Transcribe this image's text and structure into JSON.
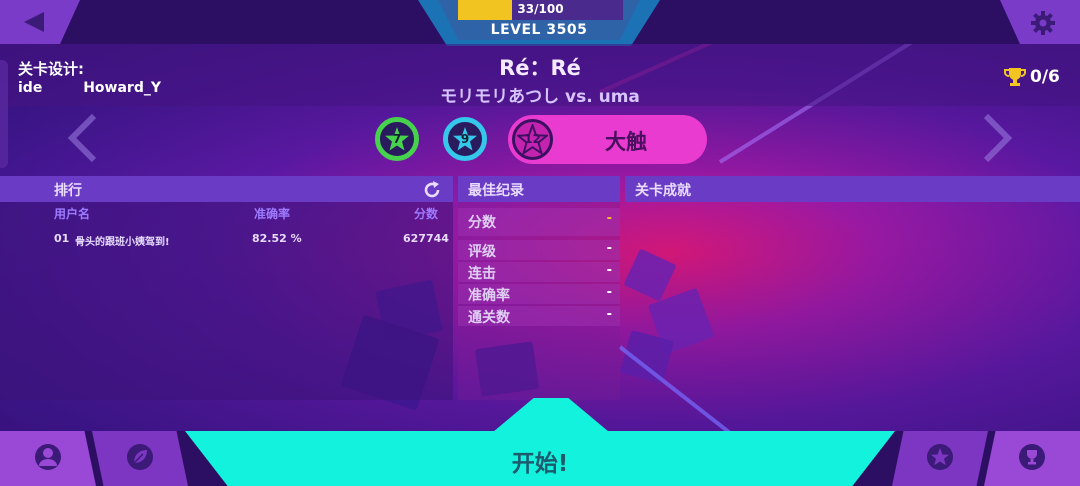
{
  "top": {
    "xp_text": "33/100",
    "xp_progress": 0.33,
    "level_text": "LEVEL 3505",
    "back_icon": "back-arrow-icon",
    "settings_icon": "gear-icon"
  },
  "header": {
    "designer_label": "关卡设计:",
    "designers": [
      "ide",
      "Howard_Y"
    ],
    "song_title": "Ré：Ré",
    "song_artist": "モリモリあつし vs. uma",
    "trophy_count": "0/6"
  },
  "difficulties": [
    {
      "level": "7",
      "color": "#47d24e"
    },
    {
      "level": "9",
      "color": "#35c8ea"
    },
    {
      "level": "12",
      "label": "大触",
      "color": "#ea3bd0",
      "selected": true
    }
  ],
  "ranking": {
    "title": "排行",
    "columns": [
      "用户名",
      "准确率",
      "分数"
    ],
    "rows": [
      {
        "rank": "01",
        "name": "骨头的跟班小姨驾到!",
        "accuracy": "82.52 %",
        "score": "627744"
      }
    ]
  },
  "best_record": {
    "title": "最佳纪录",
    "stats": [
      {
        "label": "分数",
        "value": "-",
        "accent": "#f2c421"
      },
      {
        "label": "评级",
        "value": "-"
      },
      {
        "label": "连击",
        "value": "-"
      },
      {
        "label": "准确率",
        "value": "-"
      },
      {
        "label": "通关数",
        "value": "-"
      }
    ]
  },
  "achievements": {
    "title": "关卡成就"
  },
  "bottom": {
    "start_label": "开始!",
    "nav_icons": [
      "profile-icon",
      "leaf-icon",
      "star-icon",
      "trophy-icon"
    ]
  }
}
